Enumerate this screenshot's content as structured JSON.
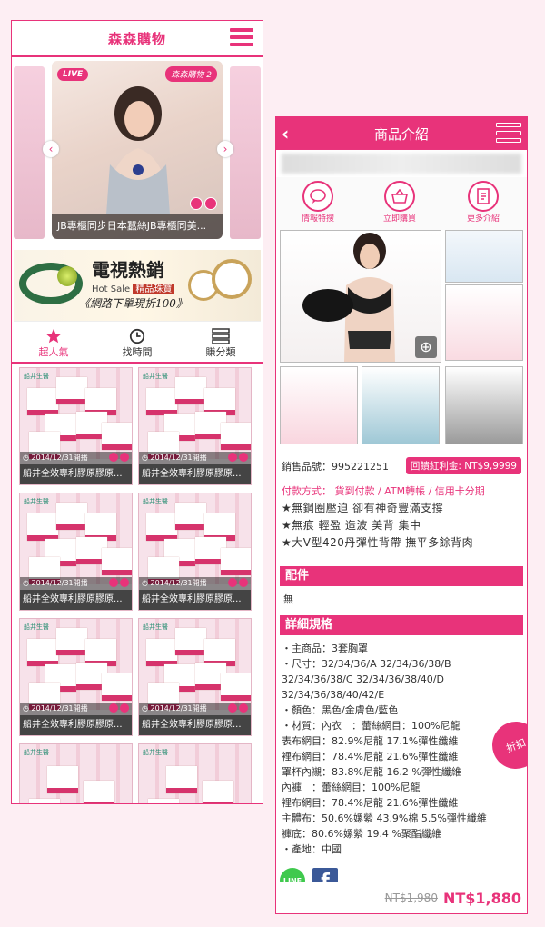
{
  "app": {
    "title": "森森購物",
    "live_badge": "LIVE",
    "brand_badge": "森森購物 2",
    "slide_caption": "JB專櫃同步日本蠶絲JB專櫃同美...",
    "banner": {
      "title": "電視熱銷",
      "sub_left": "Hot Sale",
      "sub_pill": "精品珠寶",
      "line": "《網路下單現折100》"
    },
    "tabs": [
      {
        "label": "超人氣",
        "icon": "star-icon"
      },
      {
        "label": "找時間",
        "icon": "clock-icon"
      },
      {
        "label": "賺分類",
        "icon": "list-icon"
      }
    ],
    "products": [
      {
        "date": "2014/12/31開播",
        "name": "船井全效專利膠原膠原..."
      },
      {
        "date": "2014/12/31開播",
        "name": "船井全效專利膠原膠原..."
      },
      {
        "date": "2014/12/31開播",
        "name": "船井全效專利膠原膠原..."
      },
      {
        "date": "2014/12/31開播",
        "name": "船井全效專利膠原膠原..."
      },
      {
        "date": "2014/12/31開播",
        "name": "船井全效專利膠原膠原..."
      },
      {
        "date": "2014/12/31開播",
        "name": "船井全效專利膠原膠原..."
      }
    ],
    "card_logo": "船井生醫"
  },
  "detail": {
    "title": "商品介紹",
    "actions": [
      {
        "label": "情報特搜",
        "icon": "chat-icon"
      },
      {
        "label": "立即購買",
        "icon": "basket-icon"
      },
      {
        "label": "更多介紹",
        "icon": "document-icon"
      }
    ],
    "sku": "銷售品號：995221251",
    "bonus": "回饋紅利金: NT$9,9999",
    "payment": "付款方式： 貨到付款 / ATM轉帳 / 信用卡分期",
    "features": [
      "★無鋼圈壓迫 卻有神奇豐滿支撐",
      "★無痕 輕盈 造波 美背 集中",
      "★大V型420丹彈性背帶 撫平多餘背肉"
    ],
    "accessory_heading": "配件",
    "accessory_value": "無",
    "spec_heading": "詳細規格",
    "spec_lines": [
      "・主商品：3套胸罩",
      "・尺寸：32/34/36/A 32/34/36/38/B",
      "32/34/36/38/C 32/34/36/38/40/D",
      "32/34/36/38/40/42/E",
      "・顏色：黑色/金膚色/藍色",
      "・材質：內衣　：蕾絲網目：100%尼龍",
      "表布網目：82.9%尼龍 17.1%彈性纖維",
      "裡布網目：78.4%尼龍 21.6%彈性纖維",
      "罩杯內襯：83.8%尼龍 16.2 %彈性纖維",
      "內褲　：蕾絲網目：100%尼龍",
      "裡布網目：78.4%尼龍 21.6%彈性纖維",
      "主體布：50.6%嫘縈 43.9%棉 5.5%彈性纖維",
      "褲底：80.6%嫘縈 19.4 %聚酯纖維",
      "・產地：中國"
    ],
    "social": {
      "line": "LINE",
      "facebook": "f"
    },
    "old_price": "NT$1,980",
    "new_price": "NT$1,880",
    "discount_label": "折扣"
  },
  "colors": {
    "accent": "#e8337a"
  }
}
